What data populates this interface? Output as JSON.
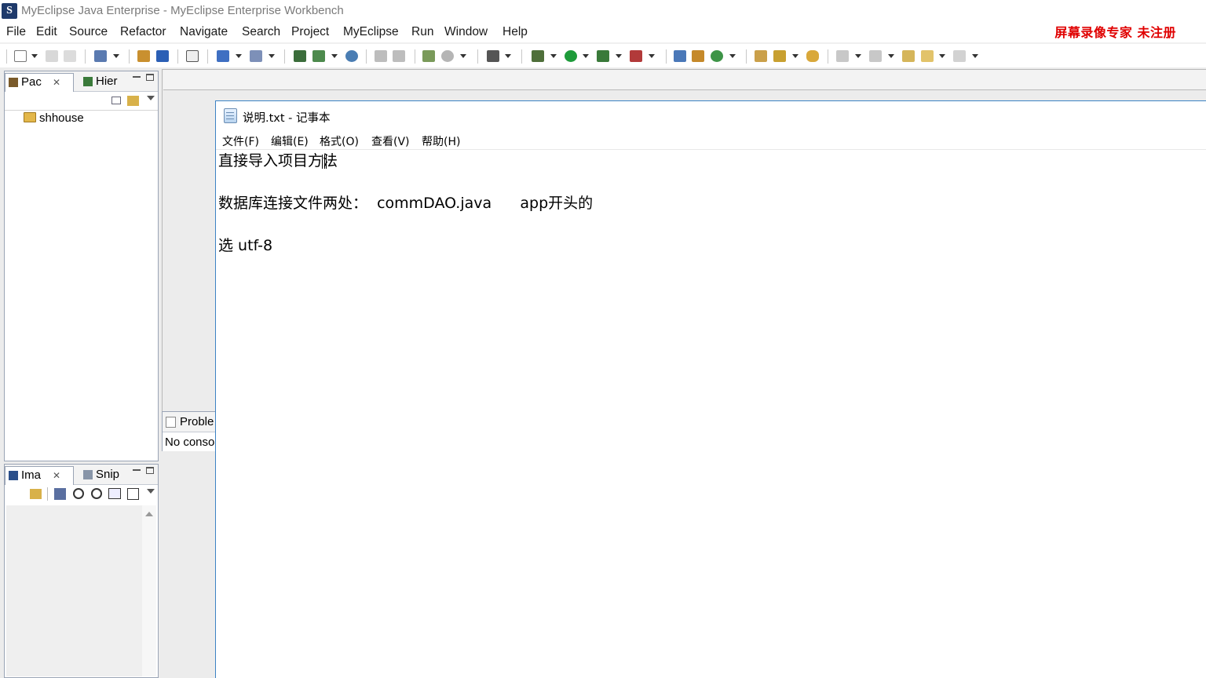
{
  "window": {
    "title": "MyEclipse Java Enterprise - MyEclipse Enterprise Workbench",
    "app_icon": "myeclipse-logo-icon"
  },
  "menubar": {
    "items": [
      "File",
      "Edit",
      "Source",
      "Refactor",
      "Navigate",
      "Search",
      "Project",
      "MyEclipse",
      "Run",
      "Window",
      "Help"
    ]
  },
  "watermark": "屏幕录像专家  未注册",
  "package_view": {
    "tabs": [
      {
        "label": "Pac",
        "icon": "package-explorer-icon",
        "active": true
      },
      {
        "label": "Hier",
        "icon": "hierarchy-icon",
        "active": false
      }
    ],
    "tree": [
      {
        "label": "shhouse",
        "icon": "project-folder-icon"
      }
    ]
  },
  "image_view": {
    "tabs": [
      {
        "label": "Ima",
        "icon": "image-viewer-icon",
        "active": true
      },
      {
        "label": "Snip",
        "icon": "snippets-icon",
        "active": false
      }
    ]
  },
  "console_view": {
    "tab_label": "Proble",
    "content": "No conso"
  },
  "notepad": {
    "title": "说明.txt - 记事本",
    "menus": [
      "文件(F)",
      "编辑(E)",
      "格式(O)",
      "查看(V)",
      "帮助(H)"
    ],
    "lines": [
      "直接导入项目方法",
      "",
      "数据库连接文件两处：  commDAO.java      app开头的",
      "",
      "选 utf-8"
    ]
  },
  "colors": {
    "watermark": "#e00000",
    "notepad_border": "#3c82c4",
    "view_border": "#9aa4b5"
  }
}
